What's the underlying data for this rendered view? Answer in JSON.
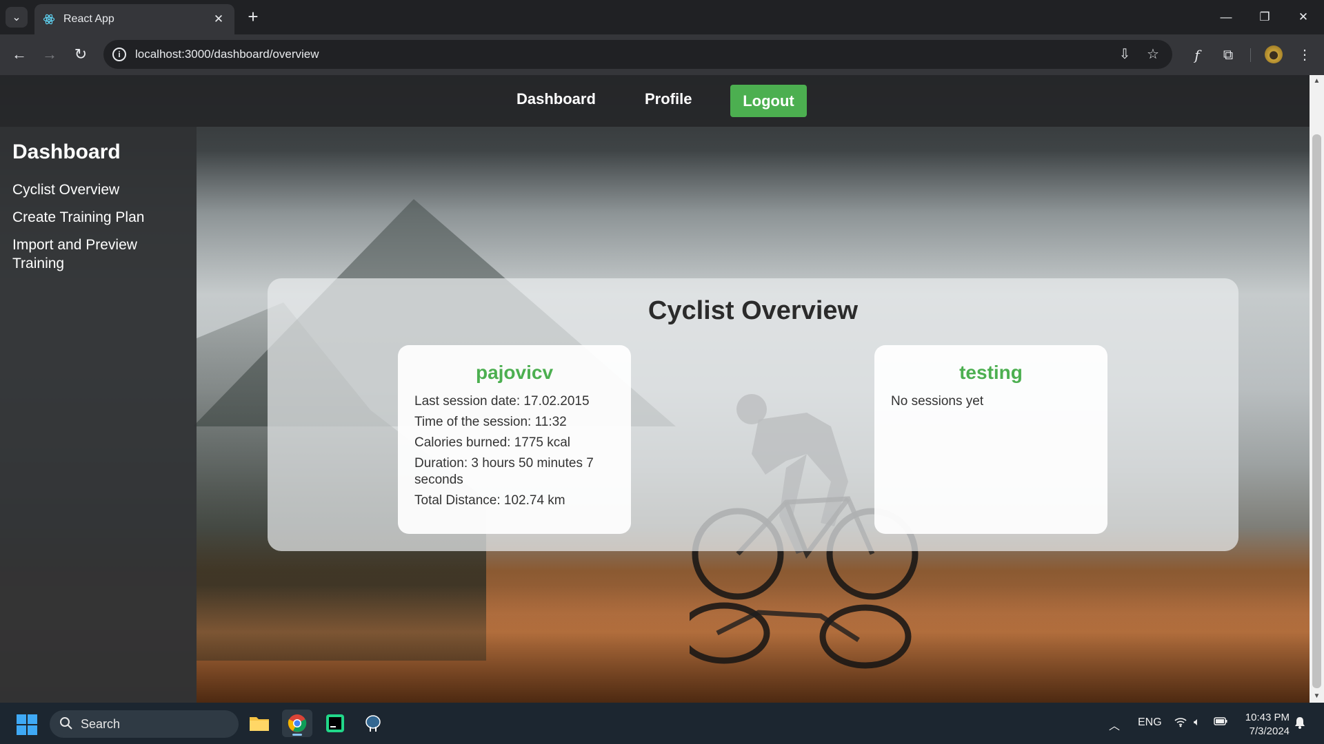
{
  "browser": {
    "tab_title": "React App",
    "url": "localhost:3000/dashboard/overview"
  },
  "topnav": {
    "dashboard": "Dashboard",
    "profile": "Profile",
    "logout": "Logout"
  },
  "sidebar": {
    "title": "Dashboard",
    "items": [
      {
        "label": "Cyclist Overview"
      },
      {
        "label": "Create Training Plan"
      },
      {
        "label": "Import and Preview Training"
      }
    ]
  },
  "overview": {
    "title": "Cyclist Overview",
    "cards": [
      {
        "name": "pajovicv",
        "lines": [
          "Last session date: 17.02.2015",
          "Time of the session: 11:32",
          "Calories burned: 1775 kcal",
          "Duration: 3 hours 50 minutes 7 seconds",
          "Total Distance: 102.74 km"
        ]
      },
      {
        "name": "testing",
        "lines": [
          "No sessions yet"
        ]
      }
    ]
  },
  "taskbar": {
    "search_placeholder": "Search",
    "language": "ENG",
    "time": "10:43 PM",
    "date": "7/3/2024"
  },
  "colors": {
    "accent_green": "#4caf50",
    "nav_bg": "#242628",
    "sidebar_bg": "#303234"
  }
}
